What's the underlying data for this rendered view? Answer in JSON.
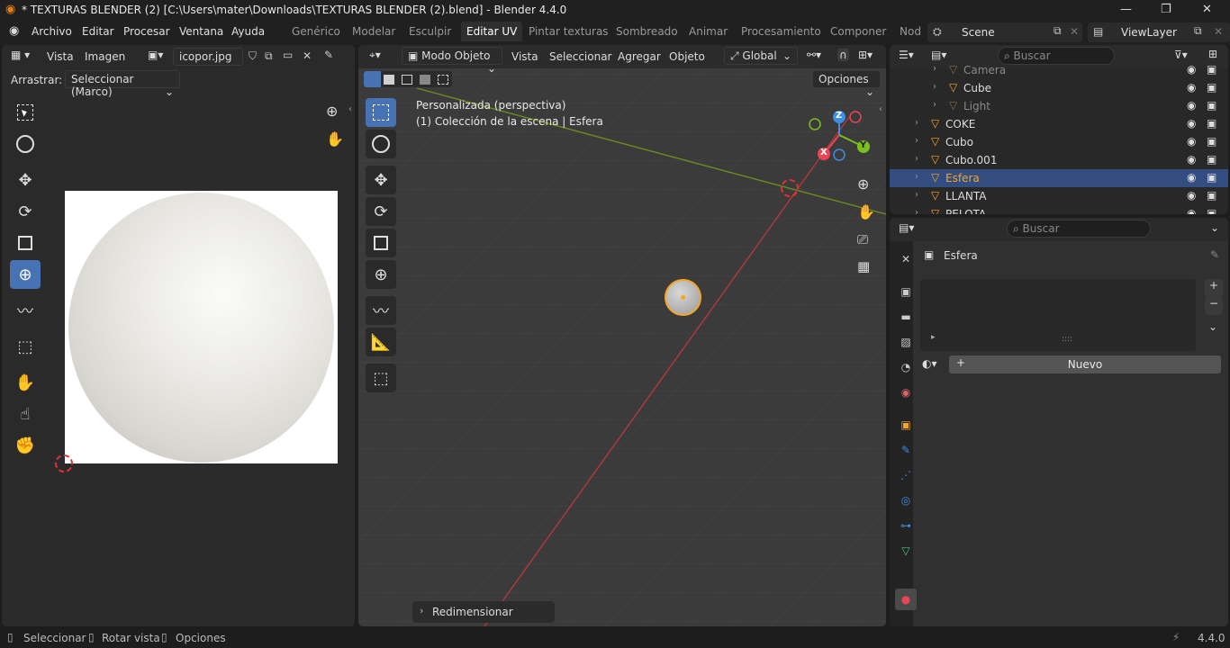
{
  "window": {
    "title": "* TEXTURAS BLENDER (2) [C:\\Users\\mater\\Downloads\\TEXTURAS BLENDER (2).blend] - Blender 4.4.0"
  },
  "menu": {
    "items": [
      "Archivo",
      "Editar",
      "Procesar",
      "Ventana",
      "Ayuda"
    ]
  },
  "workspaces": [
    "Genérico",
    "Modelar",
    "Esculpir",
    "Editar UV",
    "Pintar texturas",
    "Sombreado",
    "Animar",
    "Procesamiento",
    "Componer",
    "Nod"
  ],
  "scene": {
    "name": "Scene",
    "view_layer": "ViewLayer"
  },
  "uv_editor": {
    "menus": [
      "Vista",
      "Imagen"
    ],
    "image_name": "icopor.jpg",
    "drag_label": "Arrastrar:",
    "drag_value": "Seleccionar (Marco)"
  },
  "viewport": {
    "mode": "Modo Objeto",
    "menus": [
      "Vista",
      "Seleccionar",
      "Agregar",
      "Objeto"
    ],
    "transform": "Global",
    "options": "Opciones",
    "view_name": "Personalizada (perspectiva)",
    "collection_info": "(1) Colección de la escena | Esfera",
    "last_op": "Redimensionar",
    "axes": {
      "x": "X",
      "y": "Y",
      "z": "Z"
    }
  },
  "outliner": {
    "search_placeholder": "Buscar",
    "items": [
      {
        "name": "Camera",
        "indent": 1,
        "dim": true
      },
      {
        "name": "Cube",
        "indent": 1,
        "dim": false
      },
      {
        "name": "Light",
        "indent": 1,
        "dim": true
      },
      {
        "name": "COKE",
        "indent": 0,
        "dim": false
      },
      {
        "name": "Cubo",
        "indent": 0,
        "dim": false
      },
      {
        "name": "Cubo.001",
        "indent": 0,
        "dim": false
      },
      {
        "name": "Esfera",
        "indent": 0,
        "dim": false,
        "selected": true
      },
      {
        "name": "LLANTA",
        "indent": 0,
        "dim": false
      },
      {
        "name": "PELOTA",
        "indent": 0,
        "dim": false
      }
    ]
  },
  "properties": {
    "search_placeholder": "Buscar",
    "object_name": "Esfera",
    "new_button": "Nuevo"
  },
  "statusbar": {
    "items": [
      "Seleccionar",
      "Rotar vista",
      "Opciones"
    ],
    "version": "4.4.0"
  },
  "colors": {
    "accent": "#4772b3",
    "selected_object": "#f5a623",
    "x_axis": "#e84654",
    "y_axis": "#7bbf1e",
    "z_axis": "#3d8fe5"
  }
}
